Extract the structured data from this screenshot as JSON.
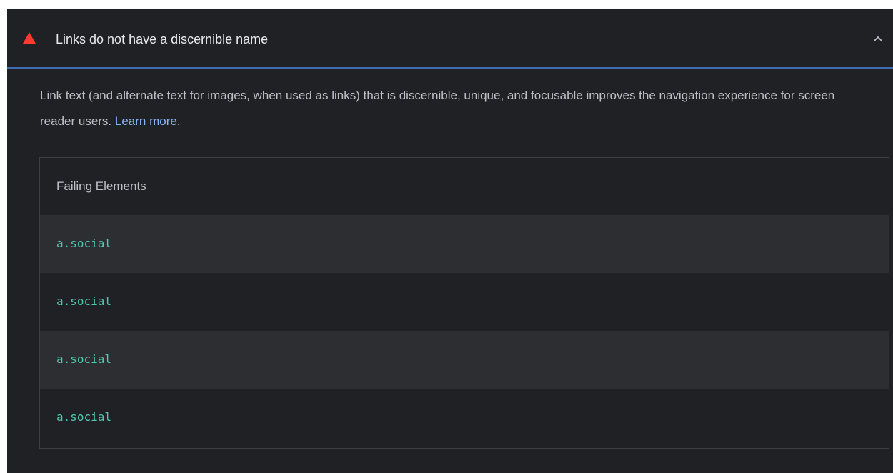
{
  "audit": {
    "title": "Links do not have a discernible name",
    "description_text": "Link text (and alternate text for images, when used as links) that is discernible, unique, and focusable improves the navigation experience for screen reader users. ",
    "learn_more": "Learn more",
    "description_end": "."
  },
  "table": {
    "header": "Failing Elements",
    "rows": [
      "a.social",
      "a.social",
      "a.social",
      "a.social"
    ]
  },
  "colors": {
    "warning": "#ff3b30",
    "link": "#8ab4f8",
    "code": "#4ec9b0",
    "accent_border": "#3f6bb5"
  },
  "icons": {
    "warning": "warning-triangle-icon",
    "collapse": "chevron-up-icon"
  }
}
